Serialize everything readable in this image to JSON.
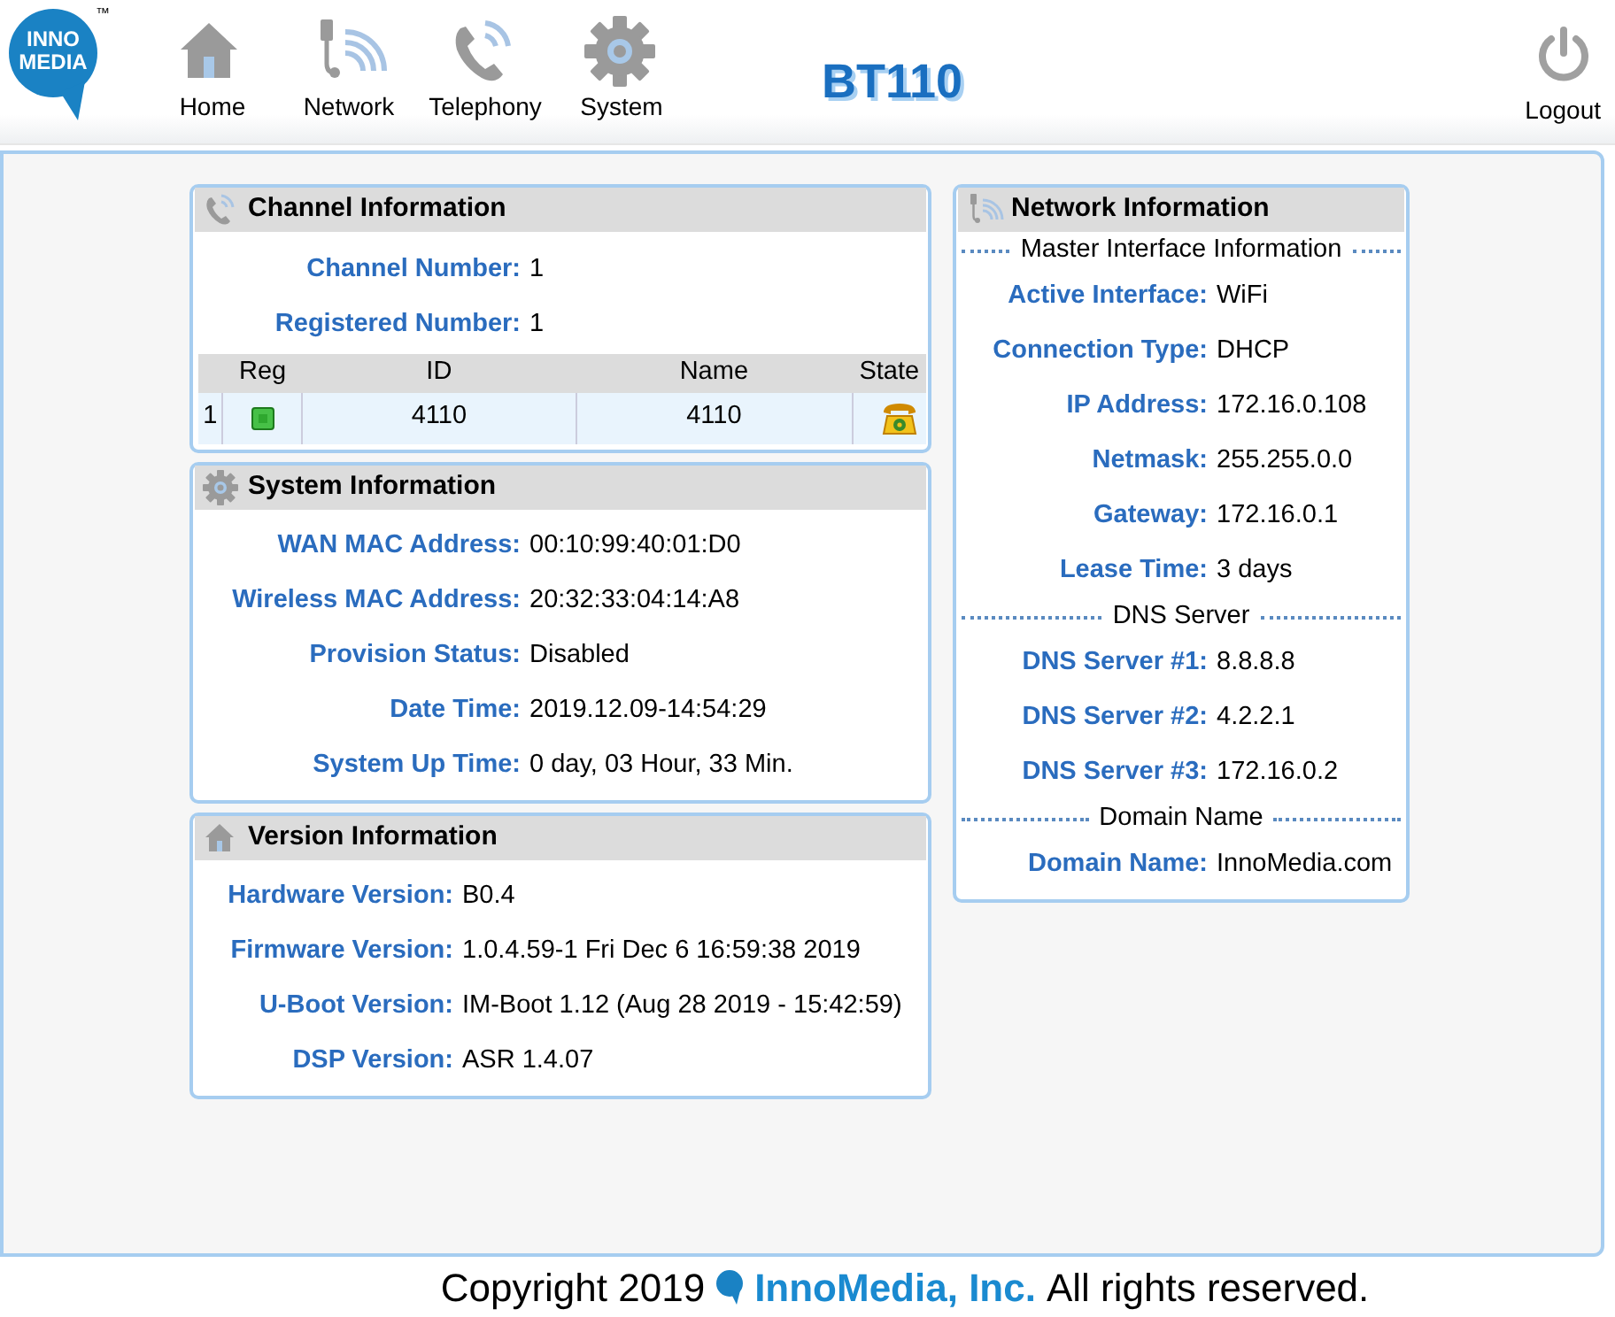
{
  "header": {
    "logo": {
      "lines": [
        "INNO",
        "MEDIA"
      ],
      "trademark": "™"
    },
    "nav": [
      {
        "label": "Home"
      },
      {
        "label": "Network"
      },
      {
        "label": "Telephony"
      },
      {
        "label": "System"
      }
    ],
    "title": "BT110",
    "logout": "Logout"
  },
  "left_panels": [
    {
      "title": "Channel Information",
      "fields": [
        {
          "label": "Channel Number:",
          "value": "1"
        },
        {
          "label": "Registered Number:",
          "value": "1"
        }
      ],
      "table": {
        "columns": [
          "Reg",
          "ID",
          "Name",
          "State"
        ],
        "rows": [
          {
            "index": "1",
            "registered": true,
            "id": "4110",
            "name": "4110"
          }
        ]
      }
    },
    {
      "title": "System Information",
      "fields": [
        {
          "label": "WAN MAC Address:",
          "value": "00:10:99:40:01:D0"
        },
        {
          "label": "Wireless MAC Address:",
          "value": "20:32:33:04:14:A8"
        },
        {
          "label": "Provision Status:",
          "value": "Disabled"
        },
        {
          "label": "Date Time:",
          "value": "2019.12.09-14:54:29"
        },
        {
          "label": "System Up Time:",
          "value": "0 day, 03 Hour, 33 Min."
        }
      ]
    },
    {
      "title": "Version Information",
      "fields": [
        {
          "label": "Hardware Version:",
          "value": "B0.4"
        },
        {
          "label": "Firmware Version:",
          "value": "1.0.4.59-1 Fri Dec 6 16:59:38 2019"
        },
        {
          "label": "U-Boot Version:",
          "value": "IM-Boot 1.12 (Aug 28 2019 - 15:42:59)"
        },
        {
          "label": "DSP Version:",
          "value": "ASR 1.4.07"
        }
      ]
    }
  ],
  "network_panel": {
    "title": "Network Information",
    "items": [
      {
        "kind": "section",
        "text": "Master Interface Information"
      },
      {
        "kind": "field",
        "label": "Active Interface:",
        "value": "WiFi"
      },
      {
        "kind": "field",
        "label": "Connection Type:",
        "value": "DHCP"
      },
      {
        "kind": "field",
        "label": "IP Address:",
        "value": "172.16.0.108"
      },
      {
        "kind": "field",
        "label": "Netmask:",
        "value": "255.255.0.0"
      },
      {
        "kind": "field",
        "label": "Gateway:",
        "value": "172.16.0.1"
      },
      {
        "kind": "field",
        "label": "Lease Time:",
        "value": "3 days"
      },
      {
        "kind": "section",
        "text": "DNS Server"
      },
      {
        "kind": "field",
        "label": "DNS Server #1:",
        "value": "8.8.8.8"
      },
      {
        "kind": "field",
        "label": "DNS Server #2:",
        "value": "4.2.2.1"
      },
      {
        "kind": "field",
        "label": "DNS Server #3:",
        "value": "172.16.0.2"
      },
      {
        "kind": "section",
        "text": "Domain Name"
      },
      {
        "kind": "field",
        "label": "Domain Name:",
        "value": "InnoMedia.com"
      }
    ]
  },
  "footer": {
    "prefix": "Copyright 2019",
    "company": "InnoMedia, Inc.",
    "suffix": "All rights reserved."
  }
}
